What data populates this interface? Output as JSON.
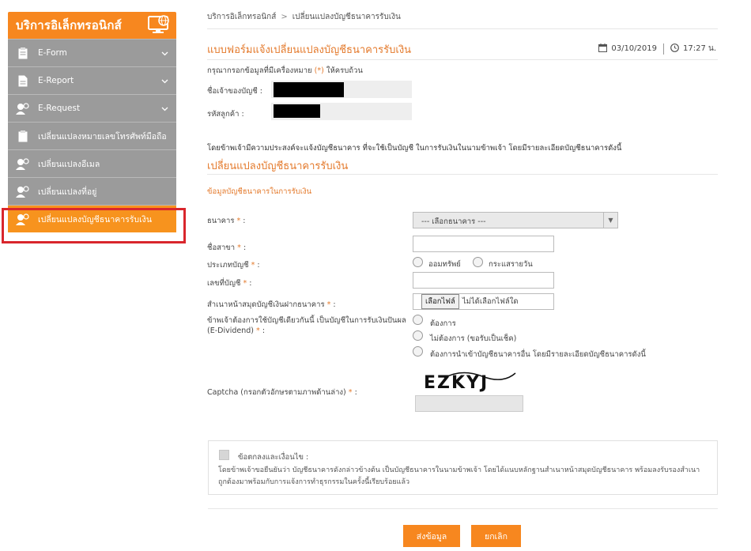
{
  "sidebar": {
    "title": "บริการอิเล็กทรอนิกส์",
    "items": [
      {
        "label": "E-Form",
        "icon": "clipboard-icon",
        "expandable": true
      },
      {
        "label": "E-Report",
        "icon": "document-icon",
        "expandable": true
      },
      {
        "label": "E-Request",
        "icon": "user-icon",
        "expandable": true
      },
      {
        "label": "เปลี่ยนแปลงหมายเลขโทรศัพท์มือถือ",
        "icon": "clipboard-icon",
        "expandable": false
      },
      {
        "label": "เปลี่ยนแปลงอีเมล",
        "icon": "user-icon",
        "expandable": false
      },
      {
        "label": "เปลี่ยนแปลงที่อยู่",
        "icon": "user-icon",
        "expandable": false
      },
      {
        "label": "เปลี่ยนแปลงบัญชีธนาคารรับเงิน",
        "icon": "user-icon",
        "expandable": false,
        "active": true
      }
    ]
  },
  "breadcrumb": {
    "home": "บริการอิเล็กทรอนิกส์",
    "sep": ">",
    "current": "เปลี่ยนแปลงบัญชีธนาคารรับเงิน"
  },
  "page": {
    "title": "แบบฟอร์มแจ้งเปลี่ยนแปลงบัญชีธนาคารรับเงิน",
    "date": "03/10/2019",
    "time": "17:27 น."
  },
  "form": {
    "required_note_pre": "กรุณากรอกข้อมูลที่มีเครื่องหมาย",
    "required_mark": "(*)",
    "required_note_post": "ให้ครบถ้วน",
    "account_owner_label": "ชื่อเจ้าของบัญชี :",
    "customer_code_label": "รหัสลูกค้า :",
    "intro": "โดยข้าพเจ้ามีความประสงค์จะแจ้งบัญชีธนาคาร ที่จะใช้เป็นบัญชี ในการรับเงินในนามข้าพเจ้า โดยมีรายละเอียดบัญชีธนาคารดังนี้",
    "section_title": "เปลี่ยนแปลงบัญชีธนาคารรับเงิน",
    "sub_title": "ข้อมูลบัญชีธนาคารในการรับเงิน",
    "bank_label": "ธนาคาร",
    "bank_placeholder": "--- เลือกธนาคาร ---",
    "branch_label": "ชื่อสาขา",
    "account_type_label": "ประเภทบัญชี",
    "account_types": [
      "ออมทรัพย์",
      "กระแสรายวัน"
    ],
    "account_no_label": "เลขที่บัญชี",
    "bookbank_label": "สำเนาหน้าสมุดบัญชีเงินฝากธนาคาร",
    "file_button": "เลือกไฟล์",
    "file_status": "ไม่ได้เลือกไฟล์ใด",
    "dividend_label_1": "ข้าพเจ้าต้องการใช้บัญชีเดียวกันนี้ เป็นบัญชีในการรับเงินปันผล",
    "dividend_label_2": "(E-Dividend)",
    "dividend_options": [
      "ต้องการ",
      "ไม่ต้องการ (ขอรับเป็นเช็ค)",
      "ต้องการนำเข้าบัญชีธนาคารอื่น โดยมีรายละเอียดบัญชีธนาคารดังนี้"
    ],
    "captcha_label": "Captcha (กรอกตัวอักษรตามภาพด้านล่าง)",
    "captcha_text": "EZKYJ",
    "required_star": "*",
    "colon": ":"
  },
  "terms": {
    "title": "ข้อตกลงและเงื่อนไข :",
    "text": "โดยข้าพเจ้าขอยืนยันว่า บัญชีธนาคารดังกล่าวข้างต้น เป็นบัญชีธนาคารในนามข้าพเจ้า โดยได้แนบหลักฐานสำเนาหน้าสมุดบัญชีธนาคาร พร้อมลงรับรองสำเนาถูกต้องมาพร้อมกับการแจ้งการทำธุรกรรมในครั้งนี้เรียบร้อยแล้ว"
  },
  "buttons": {
    "submit": "ส่งข้อมูล",
    "cancel": "ยกเลิก"
  },
  "colors": {
    "accent": "#f7871f",
    "sidebar_item": "#9b9b9b",
    "highlight_border": "#d9262c"
  }
}
